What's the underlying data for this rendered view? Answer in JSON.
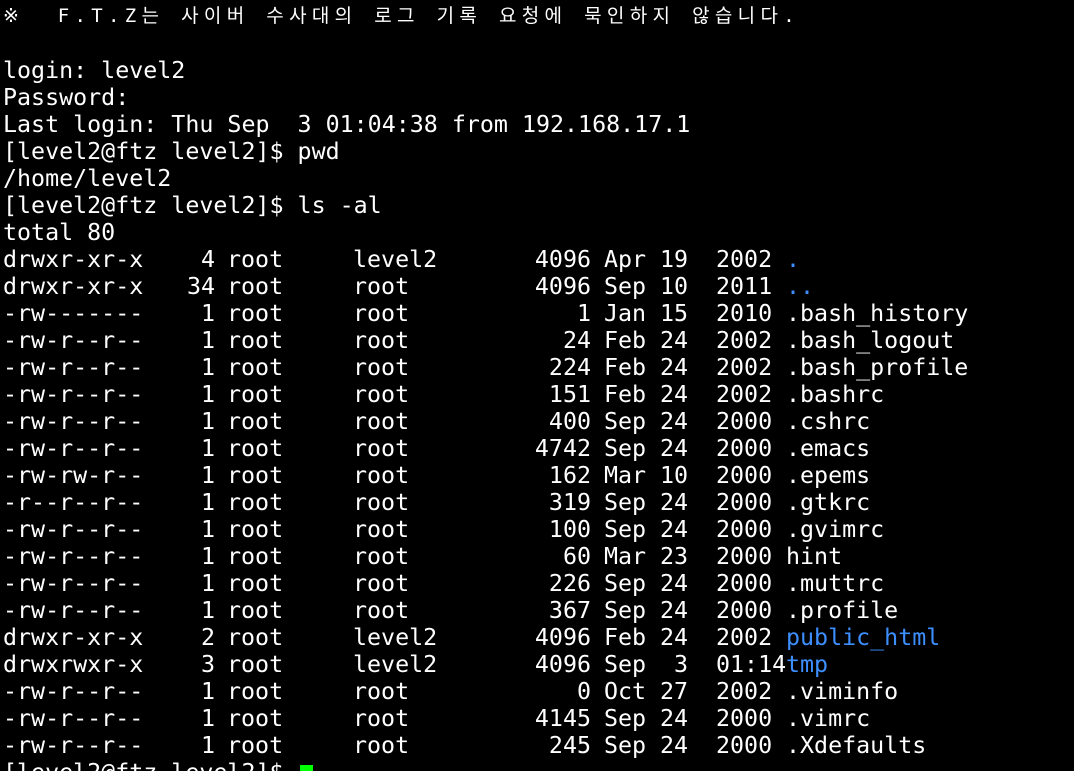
{
  "terminal": {
    "banner": "※  F.T.Z는 사이버 수사대의 로그 기록 요청에 묵인하지 않습니다.",
    "login_line": "login: level2",
    "password_line": "Password:",
    "last_login_line": "Last login: Thu Sep  3 01:04:38 from 192.168.17.1",
    "prompt": "[level2@ftz level2]$ ",
    "cmd_pwd": "pwd",
    "pwd_output": "/home/level2",
    "cmd_ls": "ls -al",
    "total_line": "total 80",
    "colors": {
      "background": "#000000",
      "foreground": "#ffffff",
      "directory": "#3d8fff",
      "cursor": "#00ff00"
    },
    "listing": [
      {
        "perm": "drwxr-xr-x",
        "links": "4",
        "owner": "root",
        "group": "level2",
        "size": "4096",
        "month": "Apr",
        "day": "19",
        "year": "2002",
        "name": ".",
        "is_dir": true
      },
      {
        "perm": "drwxr-xr-x",
        "links": "34",
        "owner": "root",
        "group": "root",
        "size": "4096",
        "month": "Sep",
        "day": "10",
        "year": "2011",
        "name": "..",
        "is_dir": true
      },
      {
        "perm": "-rw-------",
        "links": "1",
        "owner": "root",
        "group": "root",
        "size": "1",
        "month": "Jan",
        "day": "15",
        "year": "2010",
        "name": ".bash_history",
        "is_dir": false
      },
      {
        "perm": "-rw-r--r--",
        "links": "1",
        "owner": "root",
        "group": "root",
        "size": "24",
        "month": "Feb",
        "day": "24",
        "year": "2002",
        "name": ".bash_logout",
        "is_dir": false
      },
      {
        "perm": "-rw-r--r--",
        "links": "1",
        "owner": "root",
        "group": "root",
        "size": "224",
        "month": "Feb",
        "day": "24",
        "year": "2002",
        "name": ".bash_profile",
        "is_dir": false
      },
      {
        "perm": "-rw-r--r--",
        "links": "1",
        "owner": "root",
        "group": "root",
        "size": "151",
        "month": "Feb",
        "day": "24",
        "year": "2002",
        "name": ".bashrc",
        "is_dir": false
      },
      {
        "perm": "-rw-r--r--",
        "links": "1",
        "owner": "root",
        "group": "root",
        "size": "400",
        "month": "Sep",
        "day": "24",
        "year": "2000",
        "name": ".cshrc",
        "is_dir": false
      },
      {
        "perm": "-rw-r--r--",
        "links": "1",
        "owner": "root",
        "group": "root",
        "size": "4742",
        "month": "Sep",
        "day": "24",
        "year": "2000",
        "name": ".emacs",
        "is_dir": false
      },
      {
        "perm": "-rw-rw-r--",
        "links": "1",
        "owner": "root",
        "group": "root",
        "size": "162",
        "month": "Mar",
        "day": "10",
        "year": "2000",
        "name": ".epems",
        "is_dir": false
      },
      {
        "perm": "-r--r--r--",
        "links": "1",
        "owner": "root",
        "group": "root",
        "size": "319",
        "month": "Sep",
        "day": "24",
        "year": "2000",
        "name": ".gtkrc",
        "is_dir": false
      },
      {
        "perm": "-rw-r--r--",
        "links": "1",
        "owner": "root",
        "group": "root",
        "size": "100",
        "month": "Sep",
        "day": "24",
        "year": "2000",
        "name": ".gvimrc",
        "is_dir": false
      },
      {
        "perm": "-rw-r--r--",
        "links": "1",
        "owner": "root",
        "group": "root",
        "size": "60",
        "month": "Mar",
        "day": "23",
        "year": "2000",
        "name": "hint",
        "is_dir": false
      },
      {
        "perm": "-rw-r--r--",
        "links": "1",
        "owner": "root",
        "group": "root",
        "size": "226",
        "month": "Sep",
        "day": "24",
        "year": "2000",
        "name": ".muttrc",
        "is_dir": false
      },
      {
        "perm": "-rw-r--r--",
        "links": "1",
        "owner": "root",
        "group": "root",
        "size": "367",
        "month": "Sep",
        "day": "24",
        "year": "2000",
        "name": ".profile",
        "is_dir": false
      },
      {
        "perm": "drwxr-xr-x",
        "links": "2",
        "owner": "root",
        "group": "level2",
        "size": "4096",
        "month": "Feb",
        "day": "24",
        "year": "2002",
        "name": "public_html",
        "is_dir": true
      },
      {
        "perm": "drwxrwxr-x",
        "links": "3",
        "owner": "root",
        "group": "level2",
        "size": "4096",
        "month": "Sep",
        "day": "3",
        "year": "01:14",
        "name": "tmp",
        "is_dir": true
      },
      {
        "perm": "-rw-r--r--",
        "links": "1",
        "owner": "root",
        "group": "root",
        "size": "0",
        "month": "Oct",
        "day": "27",
        "year": "2002",
        "name": ".viminfo",
        "is_dir": false
      },
      {
        "perm": "-rw-r--r--",
        "links": "1",
        "owner": "root",
        "group": "root",
        "size": "4145",
        "month": "Sep",
        "day": "24",
        "year": "2000",
        "name": ".vimrc",
        "is_dir": false
      },
      {
        "perm": "-rw-r--r--",
        "links": "1",
        "owner": "root",
        "group": "root",
        "size": "245",
        "month": "Sep",
        "day": "24",
        "year": "2000",
        "name": ".Xdefaults",
        "is_dir": false
      }
    ]
  }
}
